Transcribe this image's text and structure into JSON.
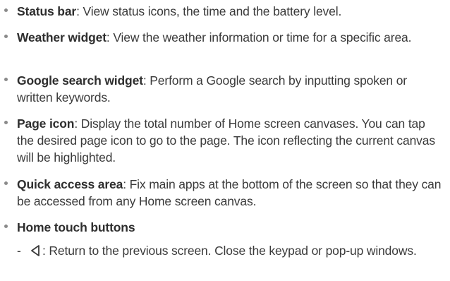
{
  "items": [
    {
      "term": "Status bar",
      "desc": ": View status icons, the time and the battery level."
    },
    {
      "term": "Weather widget",
      "desc": ": View the weather information or time for a specific area."
    },
    {
      "term": "Google search widget",
      "desc": ": Perform a Google search by inputting spoken or written keywords."
    },
    {
      "term": "Page icon",
      "desc": ": Display the total number of Home screen canvases. You can tap the desired page icon to go to the page. The icon reflecting the current canvas will be highlighted."
    },
    {
      "term": "Quick access area",
      "desc": ": Fix main apps at the bottom of the screen so that they can be accessed from any Home screen canvas."
    },
    {
      "term": "Home touch buttons",
      "desc": ""
    }
  ],
  "subitems": [
    {
      "dash": "-",
      "icon": "back-triangle-icon",
      "desc": ": Return to the previous screen. Close the keypad or pop-up windows."
    }
  ],
  "colors": {
    "text": "#3a3a3a",
    "bullet": "#8a8a8a"
  }
}
